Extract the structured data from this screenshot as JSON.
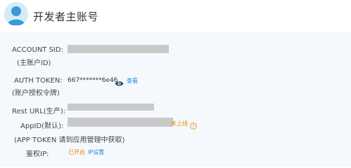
{
  "header": {
    "title": "开发者主账号",
    "avatar_icon": "user-avatar-icon"
  },
  "account": {
    "sid_label": "ACCOUNT SID:",
    "sid_sublabel": "(主账户ID)",
    "token_label": "AUTH TOKEN:",
    "token_sublabel": "(账户授权令牌)",
    "token_value": "667*******6e46",
    "token_view_label": "查看",
    "rest_url_label": "Rest URL(生产):",
    "appid_label": "AppID(默认):",
    "appid_online_label": "未上线",
    "app_token_note": "(APP TOKEN 请到应用管理中获取)",
    "auth_ip_label": "鉴权IP:",
    "auth_ip_status": "已开启",
    "ip_settings_label": "IP设置"
  },
  "colors": {
    "link_blue": "#1e8ad6",
    "status_orange": "#f08c00",
    "mask_gray": "#c9c9c9",
    "panel_bg": "#f5f9fd"
  }
}
